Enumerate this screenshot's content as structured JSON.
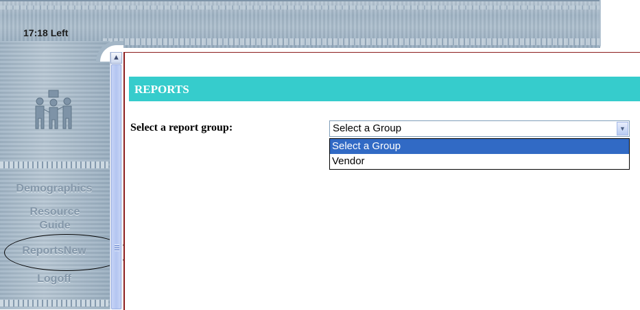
{
  "header": {
    "timer": "17:18 Left"
  },
  "sidebar": {
    "logo_icon": "family-group-icon",
    "items": [
      {
        "label": "Demographics"
      },
      {
        "label": "Resource Guide"
      },
      {
        "label": "ReportsNew"
      },
      {
        "label": "Logoff"
      }
    ]
  },
  "scrollbar": {
    "up_arrow": "▲"
  },
  "main": {
    "section_title": "REPORTS",
    "select_label": "Select a report group:",
    "select": {
      "value": "Select a Group",
      "options": [
        {
          "label": "Select a Group",
          "selected": true
        },
        {
          "label": "Vendor",
          "selected": false
        }
      ]
    }
  },
  "colors": {
    "section_bar": "#36cccc",
    "option_highlight": "#316ac5",
    "nav_text": "#8497a9"
  }
}
